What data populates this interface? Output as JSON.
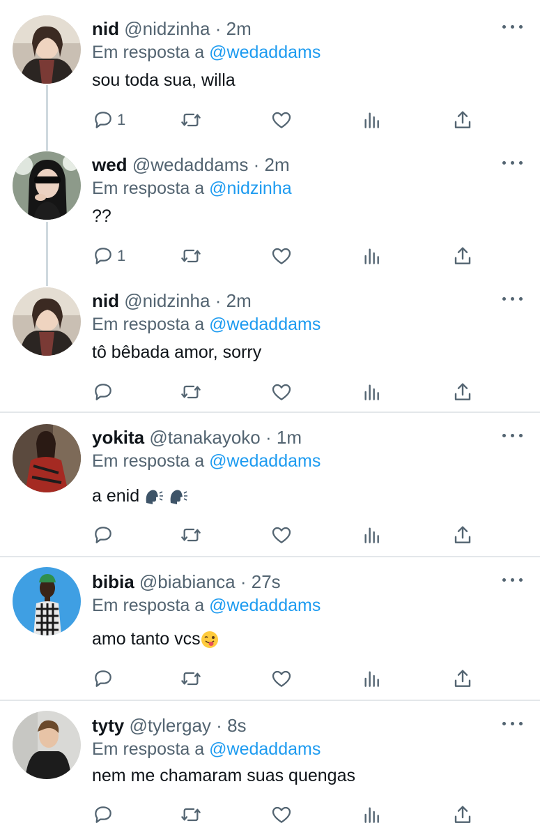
{
  "reply_prefix": "Em resposta a",
  "colors": {
    "accent": "#1d9bf0",
    "muted": "#536471",
    "divider": "#e3e7ea"
  },
  "tweets": [
    {
      "name": "nid",
      "handle": "@nidzinha",
      "time": "2m",
      "reply_to": "@wedaddams",
      "text": "sou toda sua, willa",
      "reply_count": "1",
      "avatar": "avatar-nid"
    },
    {
      "name": "wed",
      "handle": "@wedaddams",
      "time": "2m",
      "reply_to": "@nidzinha",
      "text": "??",
      "reply_count": "1",
      "avatar": "avatar-wed"
    },
    {
      "name": "nid",
      "handle": "@nidzinha",
      "time": "2m",
      "reply_to": "@wedaddams",
      "text": "tô bêbada amor, sorry",
      "reply_count": "",
      "avatar": "avatar-nid"
    },
    {
      "name": "yokita",
      "handle": "@tanakayoko",
      "time": "1m",
      "reply_to": "@wedaddams",
      "text": "a enid",
      "reply_count": "",
      "avatar": "avatar-yokita",
      "emojis": [
        "speaking-head-emoji",
        "speaking-head-emoji"
      ]
    },
    {
      "name": "bibia",
      "handle": "@biabianca",
      "time": "27s",
      "reply_to": "@wedaddams",
      "text": "amo tanto vcs",
      "reply_count": "",
      "avatar": "avatar-bibia",
      "emojis": [
        "winking-tongue-emoji"
      ]
    },
    {
      "name": "tyty",
      "handle": "@tylergay",
      "time": "8s",
      "reply_to": "@wedaddams",
      "text": "nem me chamaram suas quengas",
      "reply_count": "",
      "avatar": "avatar-tyty"
    }
  ],
  "icons": [
    "reply-icon",
    "retweet-icon",
    "like-icon",
    "views-icon",
    "share-icon",
    "more-icon"
  ]
}
